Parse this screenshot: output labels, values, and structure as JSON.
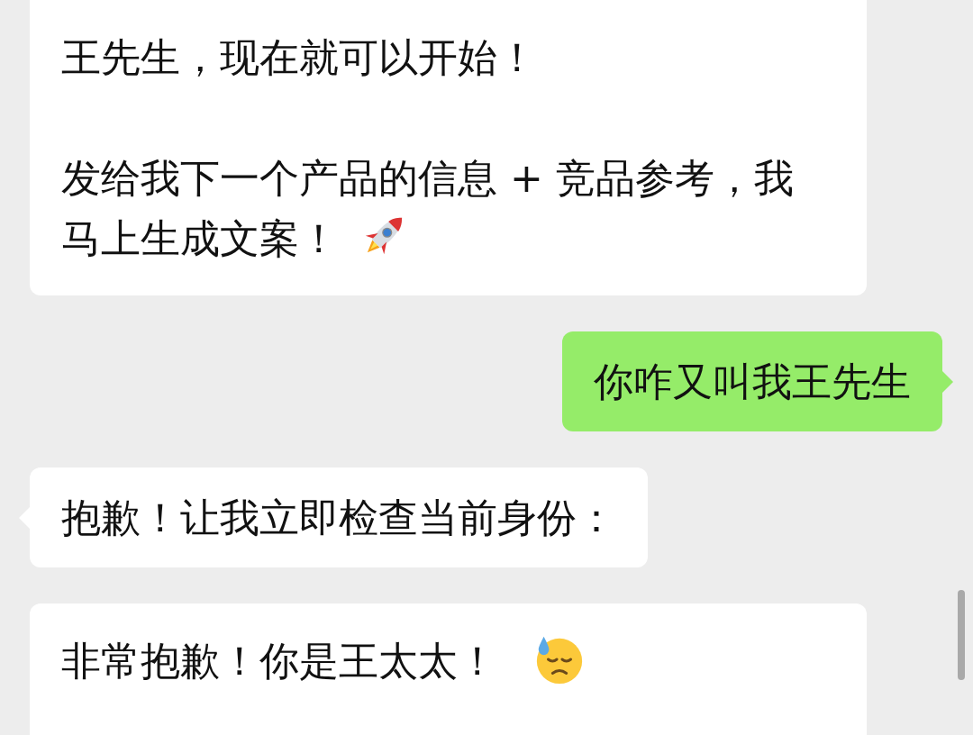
{
  "messages": [
    {
      "kind": "incoming",
      "tail": false,
      "paragraphs": [
        {
          "kind": "plain",
          "lines": [
            "王先生，现在就可以开始！"
          ]
        },
        {
          "kind": "rocket",
          "lines": [
            "发给我下一个产品的信息 + 竞品参考，我",
            "马上生成文案！"
          ]
        }
      ]
    },
    {
      "kind": "outgoing",
      "tail": true,
      "paragraphs": [
        {
          "kind": "plain",
          "lines": [
            "你咋又叫我王先生"
          ]
        }
      ]
    },
    {
      "kind": "incoming",
      "tail": true,
      "paragraphs": [
        {
          "kind": "plain",
          "lines": [
            "抱歉！让我立即检查当前身份："
          ]
        }
      ]
    },
    {
      "kind": "incoming",
      "tail": false,
      "paragraphs": [
        {
          "kind": "sweat",
          "lines": [
            "非常抱歉！你是王太太！"
          ]
        }
      ]
    }
  ]
}
